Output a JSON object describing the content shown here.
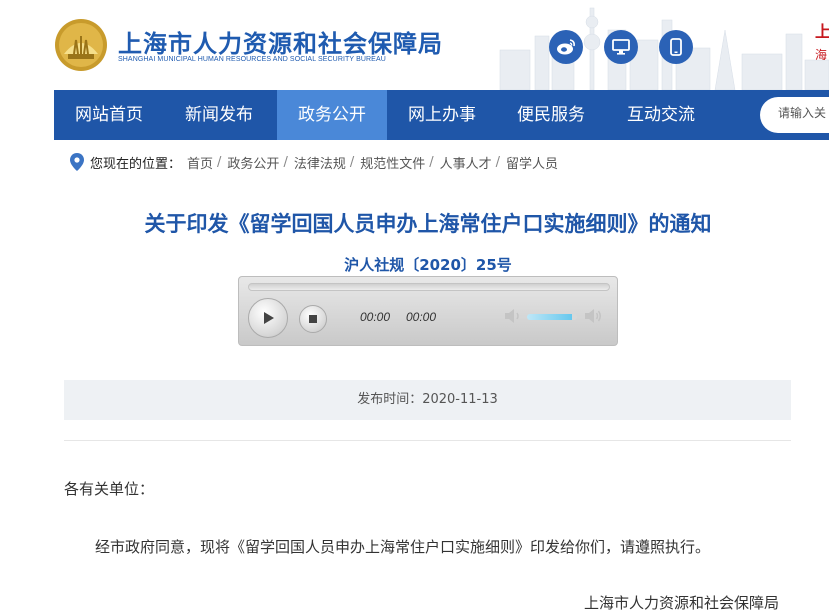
{
  "header": {
    "title": "上海市人力资源和社会保障局",
    "subtitle": "SHANGHAI MUNICIPAL HUMAN RESOURCES AND SOCIAL SECURITY BUREAU",
    "right_cut_line1": "上",
    "right_cut_line2": "海",
    "icons": [
      "weibo-icon",
      "desktop-icon",
      "mobile-icon"
    ]
  },
  "nav": {
    "items": [
      {
        "label": "网站首页"
      },
      {
        "label": "新闻发布"
      },
      {
        "label": "政务公开",
        "active": true
      },
      {
        "label": "网上办事"
      },
      {
        "label": "便民服务"
      },
      {
        "label": "互动交流"
      }
    ],
    "search_placeholder": "请输入关"
  },
  "breadcrumb": {
    "label": "您现在的位置：",
    "items": [
      "首页",
      "政务公开",
      "法律法规",
      "规范性文件",
      "人事人才",
      "留学人员"
    ]
  },
  "article": {
    "title": "关于印发《留学回国人员申办上海常住户口实施细则》的通知",
    "doc_number": "沪人社规〔2020〕25号",
    "publish_label": "发布时间：2020-11-13",
    "salutation": "各有关单位：",
    "body": "经市政府同意，现将《留学回国人员申办上海常住户口实施细则》印发给你们，请遵照执行。",
    "signature": "上海市人力资源和社会保障局"
  },
  "player": {
    "current_time": "00:00",
    "duration": "00:00",
    "volume": 0.9
  },
  "colors": {
    "brand_blue": "#1f56a8",
    "nav_active": "#4a88d8",
    "accent_red": "#c7181e"
  }
}
